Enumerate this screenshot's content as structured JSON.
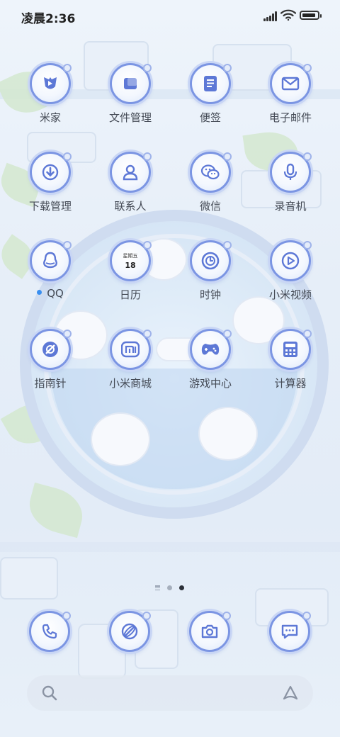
{
  "status_bar": {
    "time": "凌晨2:36",
    "battery_level": 0.9
  },
  "apps": [
    {
      "id": "mijia",
      "label": "米家",
      "icon": "mijia-icon"
    },
    {
      "id": "file-manager",
      "label": "文件管理",
      "icon": "folder-icon"
    },
    {
      "id": "notes",
      "label": "便签",
      "icon": "notes-icon"
    },
    {
      "id": "email",
      "label": "电子邮件",
      "icon": "mail-icon"
    },
    {
      "id": "downloads",
      "label": "下载管理",
      "icon": "download-icon"
    },
    {
      "id": "contacts",
      "label": "联系人",
      "icon": "contact-icon"
    },
    {
      "id": "wechat",
      "label": "微信",
      "icon": "wechat-icon"
    },
    {
      "id": "recorder",
      "label": "录音机",
      "icon": "microphone-icon"
    },
    {
      "id": "qq",
      "label": "QQ",
      "icon": "qq-penguin-icon",
      "has_new_dot": true
    },
    {
      "id": "calendar",
      "label": "日历",
      "icon": "calendar-icon",
      "weekday": "星期五",
      "day": "18"
    },
    {
      "id": "clock",
      "label": "时钟",
      "icon": "clock-icon"
    },
    {
      "id": "mi-video",
      "label": "小米视频",
      "icon": "play-icon"
    },
    {
      "id": "compass",
      "label": "指南针",
      "icon": "compass-icon"
    },
    {
      "id": "mi-store",
      "label": "小米商城",
      "icon": "mi-logo-icon"
    },
    {
      "id": "game-center",
      "label": "游戏中心",
      "icon": "gamepad-icon"
    },
    {
      "id": "calculator",
      "label": "计算器",
      "icon": "calculator-icon"
    }
  ],
  "pager": {
    "pages": 2,
    "current": 2
  },
  "dock": [
    {
      "id": "phone",
      "icon": "phone-icon"
    },
    {
      "id": "browser",
      "icon": "browser-icon"
    },
    {
      "id": "camera",
      "icon": "camera-icon"
    },
    {
      "id": "messages",
      "icon": "message-icon"
    }
  ],
  "colors": {
    "icon_ring": "#7b95e3",
    "icon_glyph": "#5d78d6",
    "new_dot": "#3a8ff0",
    "label": "#444a55",
    "active_page": "#2b2f38"
  }
}
